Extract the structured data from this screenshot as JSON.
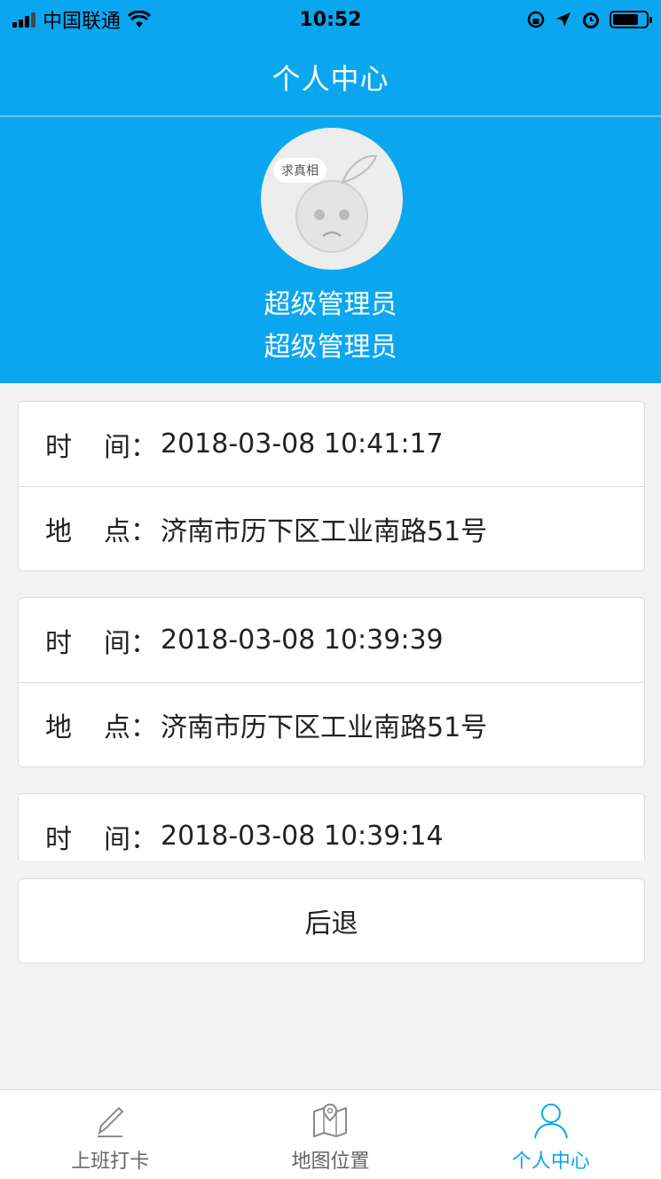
{
  "status_bar": {
    "carrier": "中国联通",
    "time": "10:52"
  },
  "nav": {
    "title": "个人中心"
  },
  "profile": {
    "avatar_text": "求真相",
    "name": "超级管理员",
    "role": "超级管理员"
  },
  "records": [
    {
      "time_label_1": "时",
      "time_label_2": "间：",
      "time": "2018-03-08 10:41:17",
      "place_label_1": "地",
      "place_label_2": "点：",
      "place": "济南市历下区工业南路51号"
    },
    {
      "time_label_1": "时",
      "time_label_2": "间：",
      "time": "2018-03-08 10:39:39",
      "place_label_1": "地",
      "place_label_2": "点：",
      "place": "济南市历下区工业南路51号"
    },
    {
      "time_label_1": "时",
      "time_label_2": "间：",
      "time": "2018-03-08 10:39:14"
    }
  ],
  "back_button": "后退",
  "tabs": [
    {
      "label": "上班打卡",
      "icon": "pencil-icon"
    },
    {
      "label": "地图位置",
      "icon": "map-icon"
    },
    {
      "label": "个人中心",
      "icon": "person-icon"
    }
  ],
  "colors": {
    "accent": "#0aa7f0",
    "background": "#f2f2f2"
  }
}
